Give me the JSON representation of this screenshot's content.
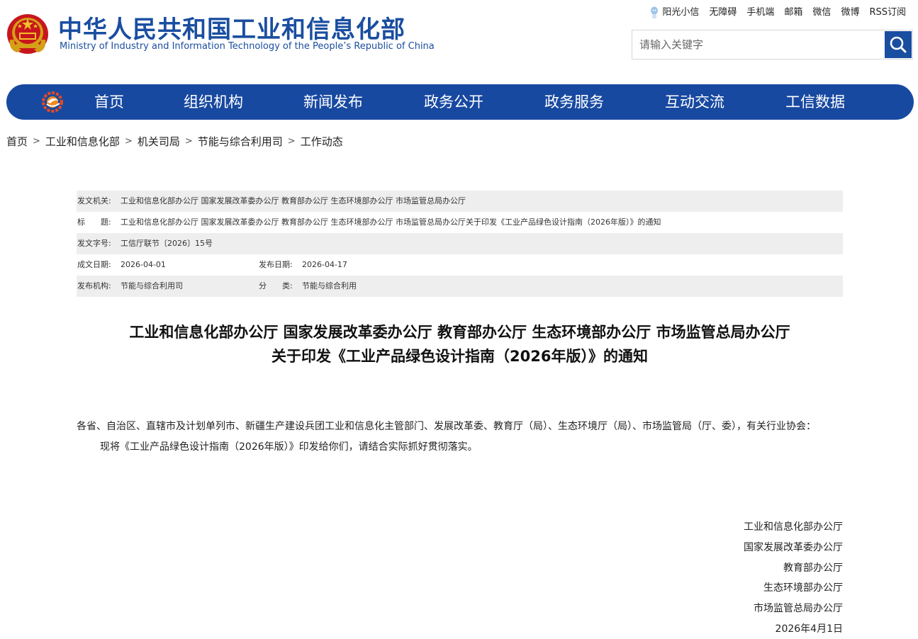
{
  "header": {
    "title_cn": "中华人民共和国工业和信息化部",
    "title_en": "Ministry of Industry and Information Technology of the People’s Republic of China",
    "emblem_icon": "national-emblem-icon"
  },
  "toplinks": [
    "阳光小信",
    "无障碍",
    "手机端",
    "邮箱",
    "微信",
    "微博",
    "RSS订阅"
  ],
  "search": {
    "placeholder": "请输入关键字",
    "icon": "search-icon"
  },
  "nav": {
    "items": [
      "首页",
      "组织机构",
      "新闻发布",
      "政务公开",
      "政务服务",
      "互动交流",
      "工信数据"
    ],
    "color": "#1849a1"
  },
  "breadcrumb": [
    "首页",
    "工业和信息化部",
    "机关司局",
    "节能与综合利用司",
    "工作动态"
  ],
  "meta": {
    "issuer_label": "发文机关:",
    "issuer": "工业和信息化部办公厅 国家发展改革委办公厅 教育部办公厅 生态环境部办公厅 市场监管总局办公厅",
    "title_label": "标　　题:",
    "title": "工业和信息化部办公厅 国家发展改革委办公厅 教育部办公厅 生态环境部办公厅 市场监管总局办公厅关于印发《工业产品绿色设计指南（2026年版）》的通知",
    "docno_label": "发文字号:",
    "docno": "工信厅联节〔2026〕15号",
    "written_label": "成文日期:",
    "written": "2026-04-01",
    "published_label": "发布日期:",
    "published": "2026-04-17",
    "org_label": "发布机构:",
    "org": "节能与综合利用司",
    "category_label": "分　　类:",
    "category": "节能与综合利用"
  },
  "article": {
    "title_line1": "工业和信息化部办公厅 国家发展改革委办公厅 教育部办公厅 生态环境部办公厅 市场监管总局办公厅",
    "title_line2": "关于印发《工业产品绿色设计指南（2026年版）》的通知",
    "para1": "各省、自治区、直辖市及计划单列市、新疆生产建设兵团工业和信息化主管部门、发展改革委、教育厅（局）、生态环境厅（局）、市场监管局（厅、委），有关行业协会：",
    "para2": "现将《工业产品绿色设计指南（2026年版）》印发给你们，请结合实际抓好贯彻落实。",
    "signatures": [
      "工业和信息化部办公厅",
      "国家发展改革委办公厅",
      "教育部办公厅",
      "生态环境部办公厅",
      "市场监管总局办公厅"
    ],
    "date": "2026年4月1日"
  }
}
